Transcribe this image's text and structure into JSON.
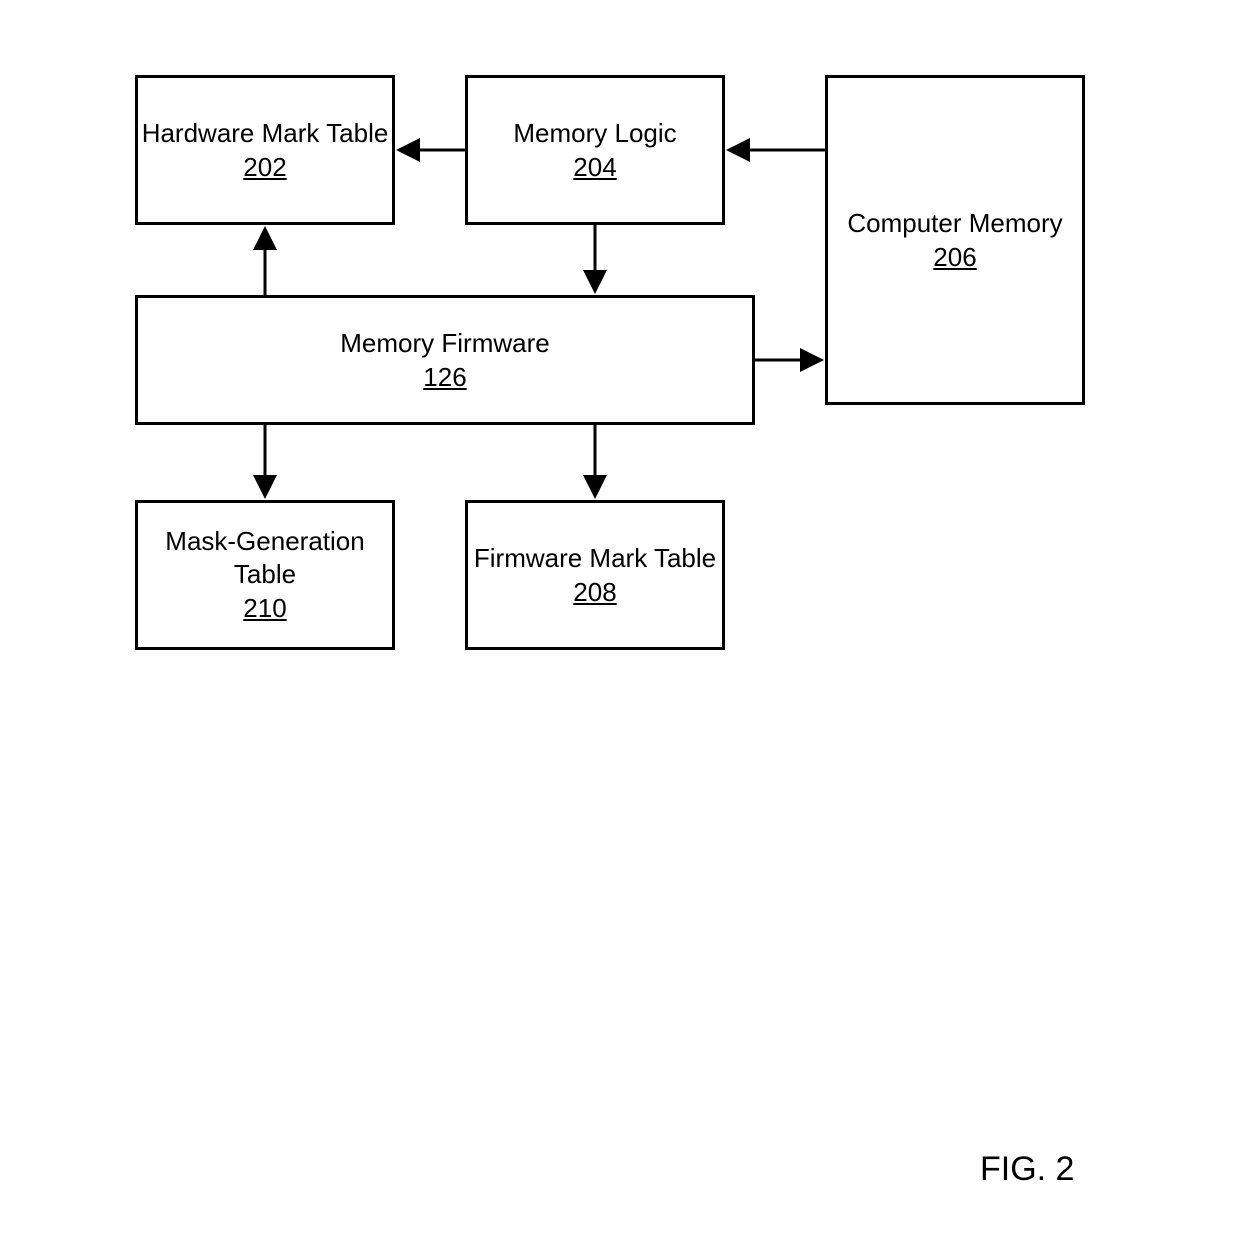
{
  "figure_label": "FIG. 2",
  "boxes": {
    "hardware_mark_table": {
      "title": "Hardware Mark Table",
      "ref": "202"
    },
    "memory_logic": {
      "title": "Memory Logic",
      "ref": "204"
    },
    "computer_memory": {
      "title": "Computer Memory",
      "ref": "206"
    },
    "memory_firmware": {
      "title": "Memory Firmware",
      "ref": "126"
    },
    "mask_gen_table": {
      "title": "Mask-Generation Table",
      "ref": "210"
    },
    "firmware_mark_table": {
      "title": "Firmware Mark Table",
      "ref": "208"
    }
  },
  "chart_data": {
    "type": "diagram",
    "title": "FIG. 2",
    "nodes": [
      {
        "id": "202",
        "label": "Hardware Mark Table"
      },
      {
        "id": "204",
        "label": "Memory Logic"
      },
      {
        "id": "206",
        "label": "Computer Memory"
      },
      {
        "id": "126",
        "label": "Memory Firmware"
      },
      {
        "id": "210",
        "label": "Mask-Generation Table"
      },
      {
        "id": "208",
        "label": "Firmware Mark Table"
      }
    ],
    "edges": [
      {
        "from": "206",
        "to": "204"
      },
      {
        "from": "204",
        "to": "202"
      },
      {
        "from": "204",
        "to": "126"
      },
      {
        "from": "126",
        "to": "202"
      },
      {
        "from": "126",
        "to": "206"
      },
      {
        "from": "126",
        "to": "210"
      },
      {
        "from": "126",
        "to": "208"
      }
    ]
  }
}
